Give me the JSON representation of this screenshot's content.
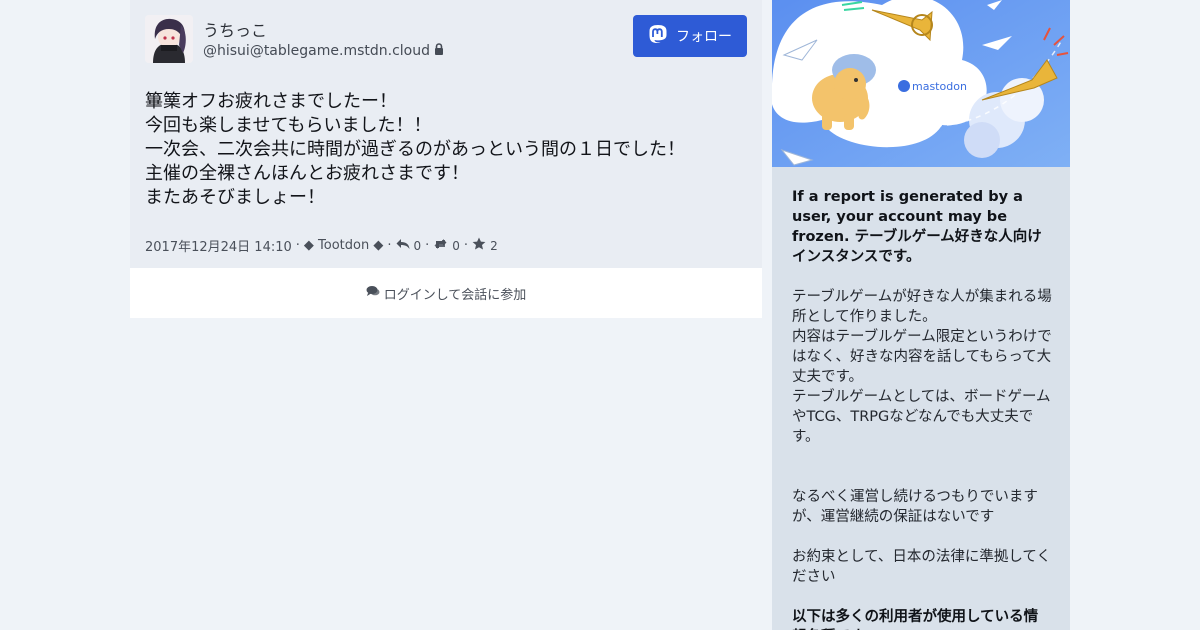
{
  "post": {
    "display_name": "うちっこ",
    "acct": "@hisui@tablegame.mstdn.cloud",
    "follow_label": "フォロー",
    "content_lines": [
      "篳篥オフお疲れさまでしたー！",
      "今回も楽しませてもらいました！！",
      "一次会、二次会共に時間が過ぎるのがあっという間の１日でした！",
      "主催の全裸さんほんとお疲れさまです！",
      "またあそびましょー！"
    ],
    "timestamp": "2017年12月24日 14:10",
    "app": "◆ Tootdon ◆",
    "replies": "0",
    "boosts": "0",
    "favourites": "2"
  },
  "reply_bar": {
    "label": "ログインして会話に参加"
  },
  "sidebar": {
    "hero_logo_text": "mastodon",
    "intro_bold": "If a report is generated by a user, your account may be frozen. テーブルゲーム好きな人向けインスタンスです。",
    "para1": "テーブルゲームが好きな人が集まれる場所として作りました。",
    "para2": "内容はテーブルゲーム限定というわけではなく、好きな内容を話してもらって大丈夫です。",
    "para3": "テーブルゲームとしては、ボードゲームやTCG、TRPGなどなんでも大丈夫です。",
    "para4": "なるべく運営し続けるつもりでいますが、運営継続の保証はないです",
    "para5": "お約束として、日本の法律に準拠してください",
    "bold2": "以下は多くの利用者が使用している情報各種です。"
  },
  "colors": {
    "accent": "#2e5bd6",
    "page_bg": "#eff3f8",
    "post_bg": "#e9edf3",
    "sidebar_bg": "#d9e1ea",
    "hero_bg": "#6b9cf0"
  }
}
